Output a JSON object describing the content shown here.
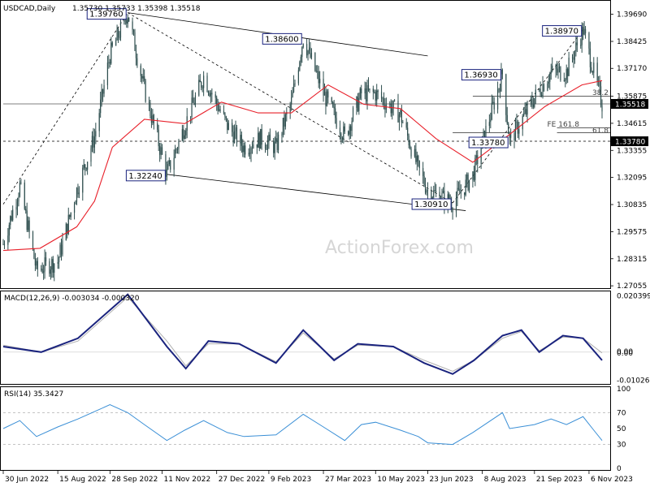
{
  "header": {
    "symbol": "USDCAD,Daily",
    "ohlc": "1.35730 1.35733 1.35398 1.35518"
  },
  "watermark": "ActionForex.com",
  "colors": {
    "candle": "#2f4f4f",
    "ma": "#e8202a",
    "macd": "#1a237e",
    "signal": "#b0b0b0",
    "rsi": "#3a8fd6",
    "trendline": "#000000",
    "label_border": "#1a237e"
  },
  "chart_data": [
    {
      "type": "candlestick",
      "title": "USDCAD,Daily",
      "ylim": [
        1.2706,
        1.402
      ],
      "y_ticks": [
        "1.39690",
        "1.38425",
        "1.37170",
        "1.35875",
        "1.34615",
        "1.33355",
        "1.32095",
        "1.30835",
        "1.29575",
        "1.28315",
        "1.27055"
      ],
      "x_ticks": [
        "30 Jun 2022",
        "15 Aug 2022",
        "28 Sep 2022",
        "11 Nov 2022",
        "27 Dec 2022",
        "9 Feb 2023",
        "27 Mar 2023",
        "10 May 2023",
        "23 Jun 2023",
        "8 Aug 2023",
        "21 Sep 2023",
        "6 Nov 2023"
      ],
      "last_price": "1.35518",
      "price_levels": [
        "1.35518",
        "1.33780"
      ],
      "level_labels": [
        "38.2",
        "FE 161.8",
        "61.8"
      ],
      "swing_labels": [
        {
          "text": "1.39760",
          "date": "2022-10-13",
          "price": 1.3976
        },
        {
          "text": "1.38600",
          "date": "2023-03-10",
          "price": 1.386
        },
        {
          "text": "1.32240",
          "date": "2022-11-15",
          "price": 1.3224
        },
        {
          "text": "1.30910",
          "date": "2023-07-14",
          "price": 1.3091
        },
        {
          "text": "1.36930",
          "date": "2023-08-25",
          "price": 1.3693
        },
        {
          "text": "1.33780",
          "date": "2023-08-31",
          "price": 1.3378
        },
        {
          "text": "1.38970",
          "date": "2023-11-01",
          "price": 1.3897
        }
      ],
      "close_path": [
        [
          "2022-06-30",
          1.29
        ],
        [
          "2022-07-14",
          1.317
        ],
        [
          "2022-07-28",
          1.278
        ],
        [
          "2022-08-15",
          1.282
        ],
        [
          "2022-08-31",
          1.315
        ],
        [
          "2022-09-15",
          1.34
        ],
        [
          "2022-09-28",
          1.378
        ],
        [
          "2022-10-13",
          1.3976
        ],
        [
          "2022-10-27",
          1.362
        ],
        [
          "2022-11-15",
          1.3224
        ],
        [
          "2022-11-30",
          1.345
        ],
        [
          "2022-12-16",
          1.368
        ],
        [
          "2023-01-05",
          1.345
        ],
        [
          "2023-01-19",
          1.335
        ],
        [
          "2023-02-02",
          1.339
        ],
        [
          "2023-02-15",
          1.335
        ],
        [
          "2023-02-28",
          1.356
        ],
        [
          "2023-03-10",
          1.386
        ],
        [
          "2023-03-27",
          1.36
        ],
        [
          "2023-04-14",
          1.34
        ],
        [
          "2023-04-28",
          1.36
        ],
        [
          "2023-05-10",
          1.36
        ],
        [
          "2023-05-31",
          1.35
        ],
        [
          "2023-06-15",
          1.325
        ],
        [
          "2023-06-23",
          1.315
        ],
        [
          "2023-07-14",
          1.3091
        ],
        [
          "2023-07-31",
          1.322
        ],
        [
          "2023-08-15",
          1.35
        ],
        [
          "2023-08-25",
          1.3693
        ],
        [
          "2023-08-31",
          1.3378
        ],
        [
          "2023-09-21",
          1.358
        ],
        [
          "2023-10-05",
          1.37
        ],
        [
          "2023-10-18",
          1.37
        ],
        [
          "2023-11-01",
          1.3897
        ],
        [
          "2023-11-10",
          1.37
        ],
        [
          "2023-11-17",
          1.3552
        ]
      ],
      "ma_path": [
        [
          "2022-06-30",
          1.287
        ],
        [
          "2022-07-31",
          1.288
        ],
        [
          "2022-08-31",
          1.298
        ],
        [
          "2022-09-15",
          1.31
        ],
        [
          "2022-09-30",
          1.335
        ],
        [
          "2022-10-27",
          1.348
        ],
        [
          "2022-11-30",
          1.346
        ],
        [
          "2022-12-31",
          1.356
        ],
        [
          "2023-01-31",
          1.351
        ],
        [
          "2023-02-28",
          1.351
        ],
        [
          "2023-03-31",
          1.364
        ],
        [
          "2023-04-30",
          1.355
        ],
        [
          "2023-05-31",
          1.353
        ],
        [
          "2023-06-30",
          1.339
        ],
        [
          "2023-07-31",
          1.328
        ],
        [
          "2023-08-31",
          1.341
        ],
        [
          "2023-09-30",
          1.354
        ],
        [
          "2023-10-31",
          1.364
        ],
        [
          "2023-11-17",
          1.366
        ]
      ]
    },
    {
      "type": "line",
      "title": "MACD(12,26,9) -0.003034 -0.000320",
      "ylim": [
        -0.011,
        0.0215
      ],
      "y_ticks": [
        "0.020399",
        "0.00",
        "0.00",
        "-0.01026"
      ],
      "series": [
        {
          "name": "MACD",
          "points": [
            [
              "2022-06-30",
              0.002
            ],
            [
              "2022-08-01",
              0.0
            ],
            [
              "2022-09-01",
              0.005
            ],
            [
              "2022-10-13",
              0.021
            ],
            [
              "2022-11-15",
              0.002
            ],
            [
              "2022-12-01",
              -0.006
            ],
            [
              "2022-12-20",
              0.004
            ],
            [
              "2023-01-15",
              0.003
            ],
            [
              "2023-02-15",
              -0.004
            ],
            [
              "2023-03-10",
              0.008
            ],
            [
              "2023-04-05",
              -0.003
            ],
            [
              "2023-04-25",
              0.003
            ],
            [
              "2023-05-25",
              0.002
            ],
            [
              "2023-06-20",
              -0.004
            ],
            [
              "2023-07-14",
              -0.008
            ],
            [
              "2023-08-01",
              -0.003
            ],
            [
              "2023-08-25",
              0.006
            ],
            [
              "2023-09-10",
              0.008
            ],
            [
              "2023-09-25",
              0.0
            ],
            [
              "2023-10-15",
              0.006
            ],
            [
              "2023-11-01",
              0.005
            ],
            [
              "2023-11-17",
              -0.003
            ]
          ]
        },
        {
          "name": "Signal",
          "points": [
            [
              "2022-06-30",
              0.0025
            ],
            [
              "2022-08-01",
              0.0
            ],
            [
              "2022-09-01",
              0.004
            ],
            [
              "2022-10-13",
              0.02
            ],
            [
              "2022-11-15",
              0.004
            ],
            [
              "2022-12-01",
              -0.005
            ],
            [
              "2022-12-20",
              0.003
            ],
            [
              "2023-01-15",
              0.003
            ],
            [
              "2023-02-15",
              -0.0035
            ],
            [
              "2023-03-10",
              0.007
            ],
            [
              "2023-04-05",
              -0.0025
            ],
            [
              "2023-04-25",
              0.0025
            ],
            [
              "2023-05-25",
              0.002
            ],
            [
              "2023-06-20",
              -0.003
            ],
            [
              "2023-07-14",
              -0.007
            ],
            [
              "2023-08-01",
              -0.003
            ],
            [
              "2023-08-25",
              0.005
            ],
            [
              "2023-09-10",
              0.0075
            ],
            [
              "2023-09-25",
              0.0005
            ],
            [
              "2023-10-15",
              0.0055
            ],
            [
              "2023-11-01",
              0.005
            ],
            [
              "2023-11-17",
              -0.0003
            ]
          ]
        }
      ]
    },
    {
      "type": "line",
      "title": "RSI(14) 35.3427",
      "ylim": [
        0,
        100
      ],
      "y_ticks": [
        "100",
        "70",
        "50",
        "30",
        "0"
      ],
      "series": [
        {
          "name": "RSI",
          "points": [
            [
              "2022-06-30",
              50
            ],
            [
              "2022-07-14",
              60
            ],
            [
              "2022-07-28",
              40
            ],
            [
              "2022-08-15",
              52
            ],
            [
              "2022-09-01",
              62
            ],
            [
              "2022-09-28",
              80
            ],
            [
              "2022-10-13",
              70
            ],
            [
              "2022-10-27",
              55
            ],
            [
              "2022-11-15",
              35
            ],
            [
              "2022-11-30",
              48
            ],
            [
              "2022-12-16",
              60
            ],
            [
              "2023-01-05",
              45
            ],
            [
              "2023-01-19",
              40
            ],
            [
              "2023-02-15",
              42
            ],
            [
              "2023-03-10",
              68
            ],
            [
              "2023-03-27",
              52
            ],
            [
              "2023-04-14",
              35
            ],
            [
              "2023-04-28",
              55
            ],
            [
              "2023-05-10",
              58
            ],
            [
              "2023-05-31",
              48
            ],
            [
              "2023-06-15",
              40
            ],
            [
              "2023-06-23",
              32
            ],
            [
              "2023-07-14",
              30
            ],
            [
              "2023-07-31",
              45
            ],
            [
              "2023-08-25",
              70
            ],
            [
              "2023-08-31",
              50
            ],
            [
              "2023-09-21",
              55
            ],
            [
              "2023-10-05",
              62
            ],
            [
              "2023-10-18",
              55
            ],
            [
              "2023-11-01",
              65
            ],
            [
              "2023-11-10",
              48
            ],
            [
              "2023-11-17",
              35
            ]
          ]
        }
      ]
    }
  ]
}
